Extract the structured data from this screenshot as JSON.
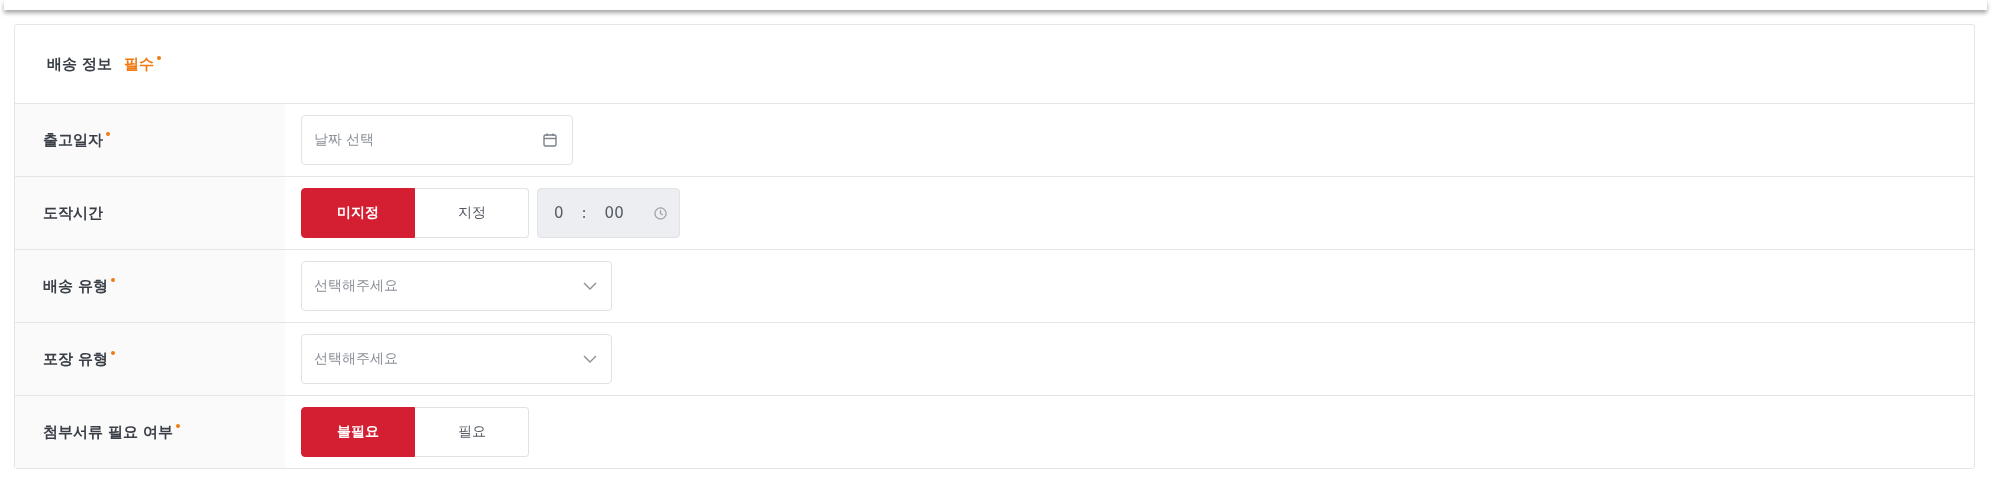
{
  "section": {
    "title": "배송 정보",
    "badge": "필수",
    "badge_required": true
  },
  "rows": [
    {
      "label": "출고일자",
      "required": true,
      "controls": [
        {
          "kind": "date",
          "placeholder": "날짜 선택"
        }
      ]
    },
    {
      "label": "도작시간",
      "required": false,
      "controls": [
        {
          "kind": "toggle",
          "options": [
            {
              "label": "미지정",
              "selected": true
            },
            {
              "label": "지정",
              "selected": false
            }
          ]
        },
        {
          "kind": "time",
          "hour": "0",
          "separator": ":",
          "minute": "00",
          "disabled": true
        }
      ]
    },
    {
      "label": "배송 유형",
      "required": true,
      "controls": [
        {
          "kind": "select",
          "placeholder": "선택해주세요"
        }
      ]
    },
    {
      "label": "포장 유형",
      "required": true,
      "controls": [
        {
          "kind": "select",
          "placeholder": "선택해주세요"
        }
      ]
    },
    {
      "label": "첨부서류 필요 여부",
      "required": true,
      "controls": [
        {
          "kind": "toggle",
          "options": [
            {
              "label": "불필요",
              "selected": true
            },
            {
              "label": "필요",
              "selected": false
            }
          ]
        }
      ]
    }
  ]
}
